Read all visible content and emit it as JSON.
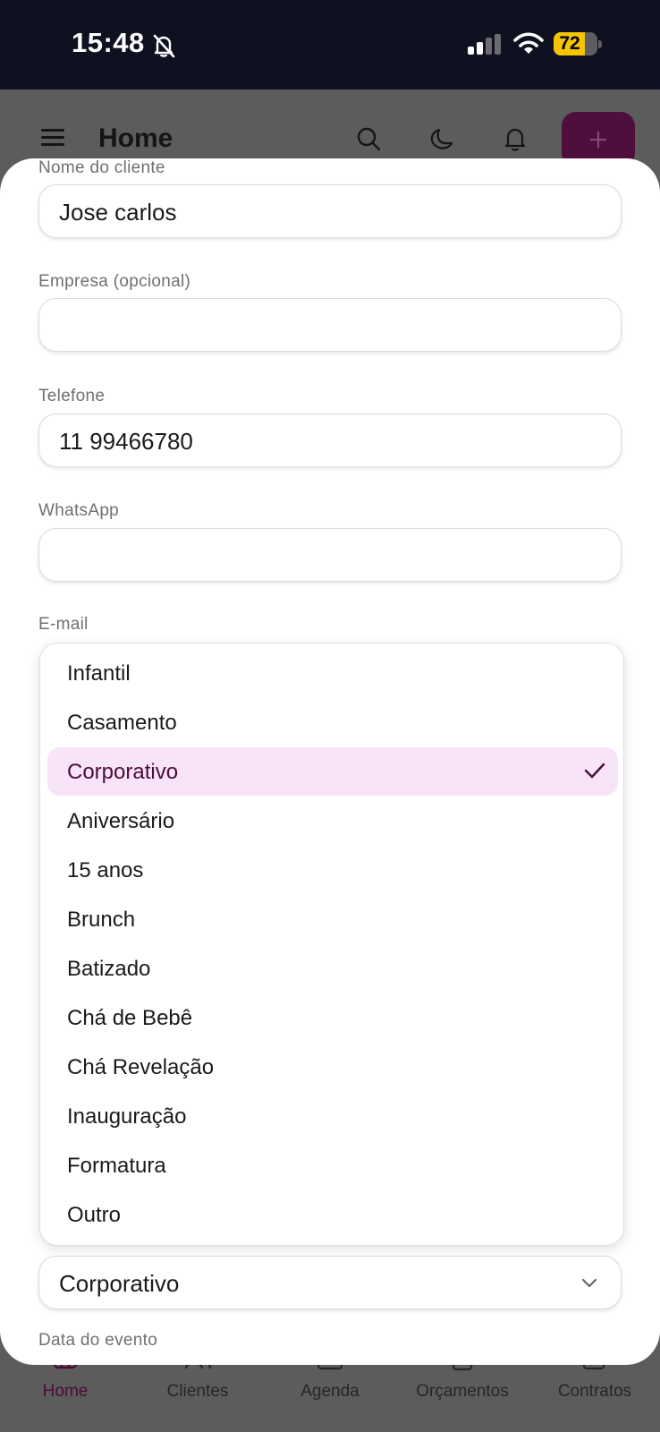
{
  "status_bar": {
    "time": "15:48",
    "battery_level": "72",
    "battery_fraction": 0.72,
    "icons": [
      "bell-slash-icon",
      "cellular-signal-icon",
      "wifi-icon",
      "battery-icon"
    ]
  },
  "app_header": {
    "title": "Home",
    "icons": [
      "menu-icon",
      "search-icon",
      "moon-icon",
      "bell-icon",
      "plus-icon"
    ]
  },
  "form": {
    "client_name": {
      "label": "Nome do cliente",
      "value": "Jose carlos"
    },
    "company": {
      "label": "Empresa (opcional)",
      "value": ""
    },
    "phone": {
      "label": "Telefone",
      "value": "11 99466780"
    },
    "whatsapp": {
      "label": "WhatsApp",
      "value": ""
    },
    "email": {
      "label": "E-mail"
    },
    "event_type": {
      "value": "Corporativo"
    },
    "event_date": {
      "label": "Data do evento"
    }
  },
  "dropdown": {
    "selected": "Corporativo",
    "options": [
      "Infantil",
      "Casamento",
      "Corporativo",
      "Aniversário",
      "15 anos",
      "Brunch",
      "Batizado",
      "Chá de Bebê",
      "Chá Revelação",
      "Inauguração",
      "Formatura",
      "Outro"
    ]
  },
  "bottom_nav": {
    "active": "Home",
    "items": [
      {
        "label": "Home",
        "icon": "home-icon"
      },
      {
        "label": "Clientes",
        "icon": "users-icon"
      },
      {
        "label": "Agenda",
        "icon": "calendar-icon"
      },
      {
        "label": "Orçamentos",
        "icon": "document-icon"
      },
      {
        "label": "Contratos",
        "icon": "edit-icon"
      }
    ]
  },
  "colors": {
    "accent": "#4a0c36",
    "selected_option_bg": "#f7e4f9",
    "battery": "#f5c400",
    "status_bar_bg": "#0f1020"
  }
}
